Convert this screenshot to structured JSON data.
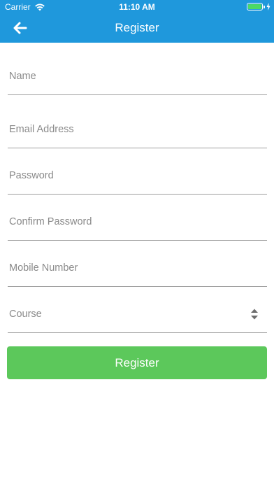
{
  "status_bar": {
    "carrier": "Carrier",
    "time": "11:10 AM",
    "battery_level": 1.0
  },
  "nav": {
    "title": "Register",
    "back_icon": "arrow-left-icon"
  },
  "form": {
    "name": {
      "placeholder": "Name",
      "value": ""
    },
    "email": {
      "placeholder": "Email Address",
      "value": ""
    },
    "password": {
      "placeholder": "Password",
      "value": ""
    },
    "confirm_password": {
      "placeholder": "Confirm Password",
      "value": ""
    },
    "mobile": {
      "placeholder": "Mobile Number",
      "value": ""
    },
    "course": {
      "selected_label": "Course",
      "icon": "select-arrows-icon"
    },
    "submit_label": "Register"
  },
  "colors": {
    "header": "#1f98dc",
    "button": "#5cc85b",
    "battery": "#4cd964"
  }
}
